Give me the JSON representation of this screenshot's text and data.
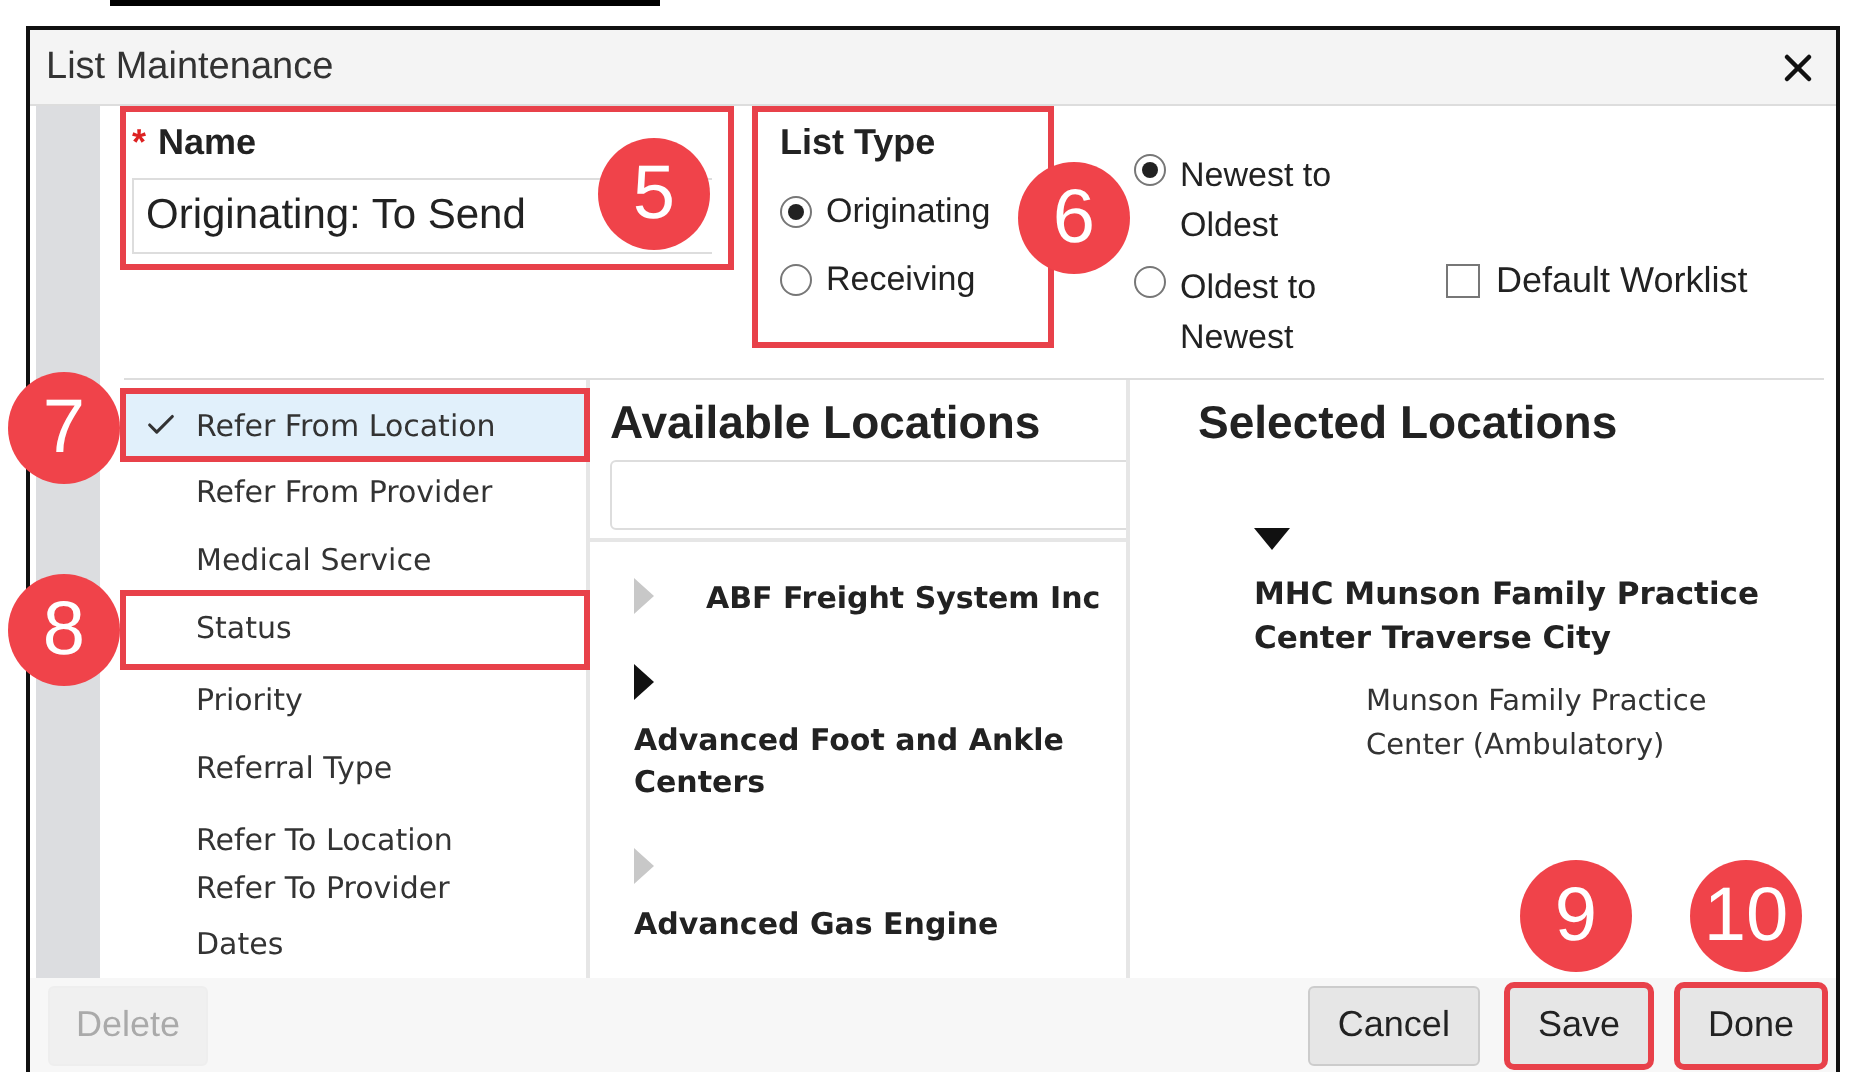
{
  "window": {
    "title": "List Maintenance"
  },
  "name_field": {
    "label": "Name",
    "required_mark": "*",
    "value": "Originating: To Send",
    "highlighted": true,
    "callout": "5"
  },
  "list_type": {
    "label": "List Type",
    "highlighted": true,
    "options": [
      {
        "label": "Originating",
        "selected": true
      },
      {
        "label": "Receiving",
        "selected": false
      }
    ]
  },
  "sort_order": {
    "callout": "6",
    "options": [
      {
        "label": "Newest to Oldest",
        "selected": true
      },
      {
        "label": "Oldest to Newest",
        "selected": false
      }
    ]
  },
  "default_worklist": {
    "label": "Default Worklist",
    "checked": false
  },
  "filters": [
    {
      "label": "Refer From Location",
      "checked": true,
      "selected": true,
      "highlighted": true,
      "callout": "7"
    },
    {
      "label": "Refer From Provider",
      "checked": false,
      "selected": false,
      "highlighted": false
    },
    {
      "label": "Medical Service",
      "checked": false,
      "selected": false,
      "highlighted": false
    },
    {
      "label": "Status",
      "checked": false,
      "selected": false,
      "highlighted": true,
      "callout": "8"
    },
    {
      "label": "Priority",
      "checked": false,
      "selected": false,
      "highlighted": false
    },
    {
      "label": "Referral Type",
      "checked": false,
      "selected": false,
      "highlighted": false
    },
    {
      "label": "Refer To Location",
      "checked": false,
      "selected": false,
      "highlighted": false
    },
    {
      "label": "Refer To Provider",
      "checked": false,
      "selected": false,
      "highlighted": false
    },
    {
      "label": "Dates",
      "checked": false,
      "selected": false,
      "highlighted": false
    }
  ],
  "available": {
    "title": "Available Locations",
    "items": [
      {
        "name": "ABF Freight System Inc",
        "expanded": false,
        "inline": true
      },
      {
        "name": "Advanced Foot and Ankle Centers",
        "expanded": false,
        "inline": false
      },
      {
        "name": "Advanced Gas Engine",
        "expanded": false,
        "inline": false
      }
    ]
  },
  "selected": {
    "title": "Selected Locations",
    "groups": [
      {
        "name": "MHC Munson Family Practice Center Traverse City",
        "expanded": true,
        "children": [
          {
            "name": "Munson Family Practice Center (Ambulatory)"
          }
        ]
      }
    ]
  },
  "buttons": [
    {
      "label": "Delete",
      "disabled": true,
      "highlighted": false
    },
    {
      "label": "Cancel",
      "disabled": false,
      "highlighted": false
    },
    {
      "label": "Save",
      "disabled": false,
      "highlighted": true,
      "callout": "9"
    },
    {
      "label": "Done",
      "disabled": false,
      "highlighted": true,
      "callout": "10"
    }
  ]
}
